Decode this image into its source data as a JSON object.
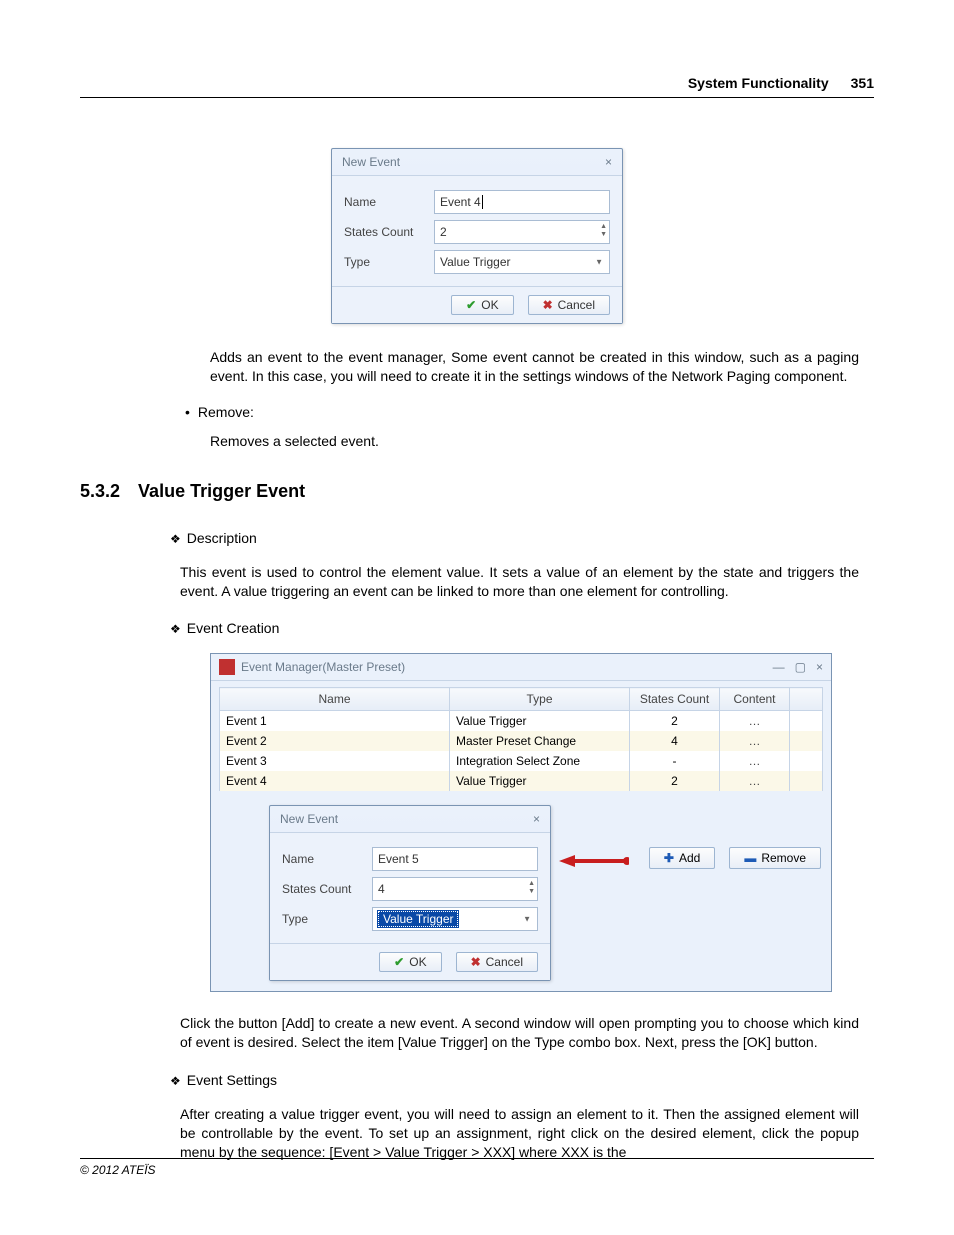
{
  "header": {
    "chapter": "System Functionality",
    "page_number": "351"
  },
  "dialog1": {
    "title": "New Event",
    "name_label": "Name",
    "name_value": "Event 4",
    "states_label": "States Count",
    "states_value": "2",
    "type_label": "Type",
    "type_value": "Value Trigger",
    "ok": "OK",
    "cancel": "Cancel"
  },
  "para_add": "Adds an event to the event manager, Some event cannot be created in this window, such as a paging event. In this case, you will need to create it in the settings windows of the Network Paging component.",
  "bullet_remove_label": "Remove:",
  "para_remove": "Removes a selected event.",
  "section": {
    "number": "5.3.2",
    "title": "Value Trigger Event"
  },
  "sub_heading_desc": "Description",
  "para_desc": "This event is used to control the element value. It sets a value of an element by the state and triggers the event. A value triggering an event can be linked to more than one element for controlling.",
  "sub_heading_creation": "Event Creation",
  "event_manager": {
    "title": "Event Manager(Master Preset)",
    "col_name": "Name",
    "col_type": "Type",
    "col_states": "States Count",
    "col_content": "Content",
    "rows": [
      {
        "name": "Event 1",
        "type": "Value Trigger",
        "states": "2",
        "content": "…"
      },
      {
        "name": "Event 2",
        "type": "Master Preset Change",
        "states": "4",
        "content": "…"
      },
      {
        "name": "Event 3",
        "type": "Integration Select Zone",
        "states": "-",
        "content": "…"
      },
      {
        "name": "Event 4",
        "type": "Value Trigger",
        "states": "2",
        "content": "…"
      }
    ],
    "add": "Add",
    "remove": "Remove"
  },
  "dialog2": {
    "title": "New Event",
    "name_label": "Name",
    "name_value": "Event 5",
    "states_label": "States Count",
    "states_value": "4",
    "type_label": "Type",
    "type_value": "Value Trigger",
    "ok": "OK",
    "cancel": "Cancel"
  },
  "para_click_add": "Click the button [Add] to create a new event. A second window will open prompting you to choose which kind of event is desired. Select the item [Value Trigger] on the Type combo box. Next, press the [OK] button.",
  "sub_heading_settings": "Event Settings",
  "para_settings": "After creating a value trigger event, you will need to assign an element to it. Then the assigned element will be controllable by the event. To set up an assignment, right click on the desired element, click the popup menu by the sequence: [Event > Value Trigger > XXX] where XXX is the",
  "footer": "© 2012 ATEÏS"
}
